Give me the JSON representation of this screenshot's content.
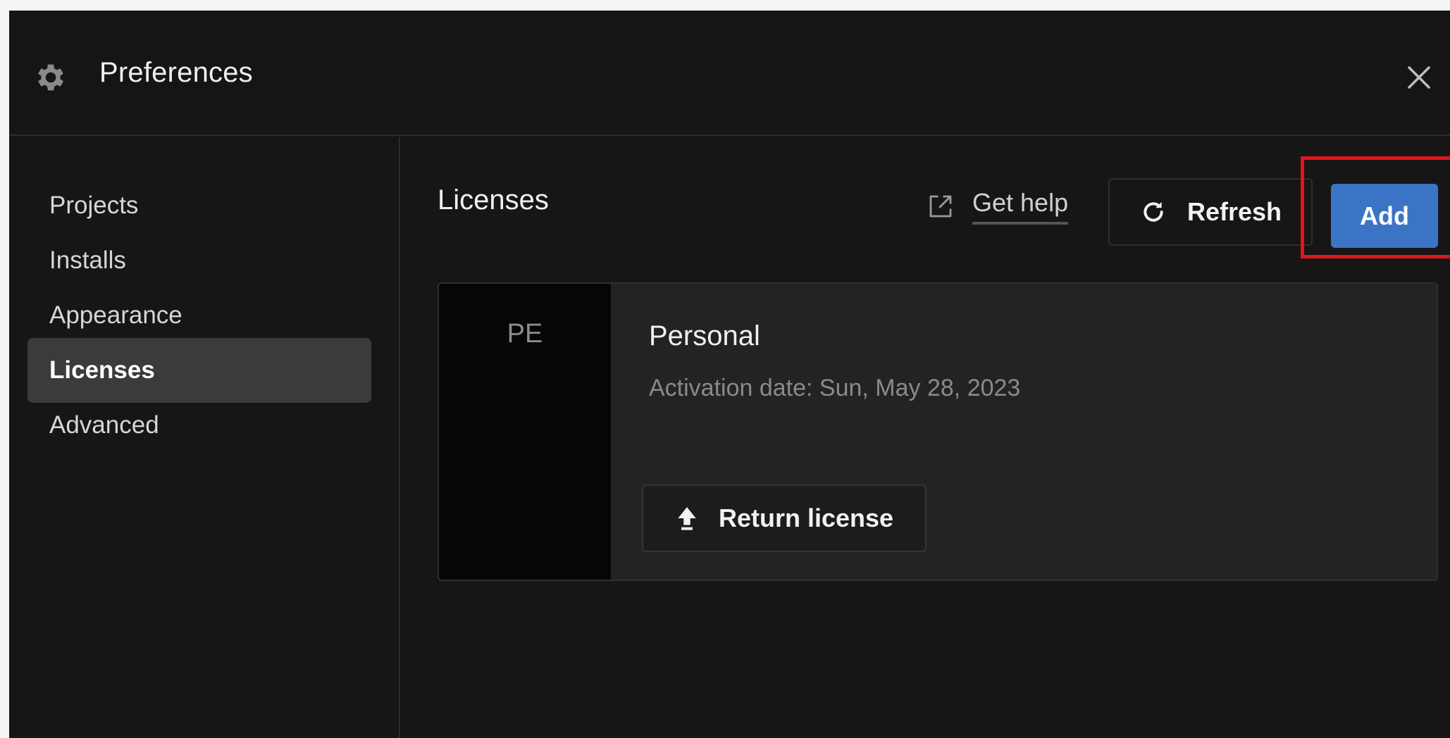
{
  "window": {
    "title": "Preferences",
    "icon": "gear-icon",
    "close_icon": "close-icon"
  },
  "sidebar": {
    "items": [
      {
        "label": "Projects",
        "active": false
      },
      {
        "label": "Installs",
        "active": false
      },
      {
        "label": "Appearance",
        "active": false
      },
      {
        "label": "Licenses",
        "active": true
      },
      {
        "label": "Advanced",
        "active": false
      }
    ]
  },
  "content": {
    "title": "Licenses",
    "get_help": {
      "label": "Get help",
      "icon": "external-link-icon"
    },
    "refresh": {
      "label": "Refresh",
      "icon": "refresh-icon"
    },
    "add": {
      "label": "Add"
    }
  },
  "license": {
    "badge": "PE",
    "name": "Personal",
    "activation": "Activation date: Sun, May 28, 2023",
    "return_button": {
      "label": "Return license",
      "icon": "upload-arrow-icon"
    }
  },
  "colors": {
    "background": "#161616",
    "accent": "#3b74c5",
    "highlight": "#e3141b",
    "active_item": "#3b3b3b"
  }
}
